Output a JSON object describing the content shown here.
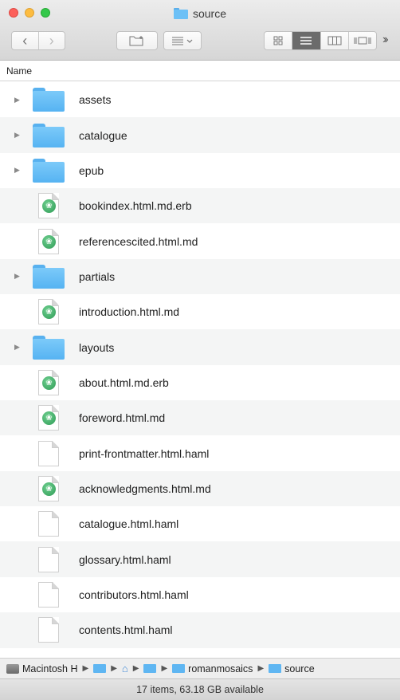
{
  "window": {
    "title": "source"
  },
  "toolbar": {
    "back_icon": "chevron-left",
    "forward_icon": "chevron-right",
    "new_folder_icon": "new-folder",
    "arrange_icon": "arrange-list",
    "views": [
      "icon-view",
      "list-view",
      "column-view",
      "cover-flow-view"
    ],
    "active_view": "list-view",
    "overflow_icon": "double-chevron-right"
  },
  "columns": {
    "name": "Name"
  },
  "files": [
    {
      "name": "assets",
      "kind": "folder"
    },
    {
      "name": "catalogue",
      "kind": "folder"
    },
    {
      "name": "epub",
      "kind": "folder"
    },
    {
      "name": "bookindex.html.md.erb",
      "kind": "markdown"
    },
    {
      "name": "referencescited.html.md",
      "kind": "markdown"
    },
    {
      "name": "partials",
      "kind": "folder"
    },
    {
      "name": "introduction.html.md",
      "kind": "markdown"
    },
    {
      "name": "layouts",
      "kind": "folder"
    },
    {
      "name": "about.html.md.erb",
      "kind": "markdown"
    },
    {
      "name": "foreword.html.md",
      "kind": "markdown"
    },
    {
      "name": "print-frontmatter.html.haml",
      "kind": "document"
    },
    {
      "name": "acknowledgments.html.md",
      "kind": "markdown"
    },
    {
      "name": "catalogue.html.haml",
      "kind": "document"
    },
    {
      "name": "glossary.html.haml",
      "kind": "document"
    },
    {
      "name": "contributors.html.haml",
      "kind": "document"
    },
    {
      "name": "contents.html.haml",
      "kind": "document"
    }
  ],
  "path": [
    {
      "label": "Macintosh H",
      "icon": "hard-drive"
    },
    {
      "label": "",
      "icon": "users-folder"
    },
    {
      "label": "",
      "icon": "home"
    },
    {
      "label": "",
      "icon": "folder"
    },
    {
      "label": "romanmosaics",
      "icon": "folder"
    },
    {
      "label": "source",
      "icon": "folder"
    }
  ],
  "status": {
    "text": "17 items, 63.18 GB available"
  },
  "colors": {
    "folder": "#56b3f2",
    "active_view": "#6b6b6b",
    "md_badge": "#2e9a55"
  }
}
